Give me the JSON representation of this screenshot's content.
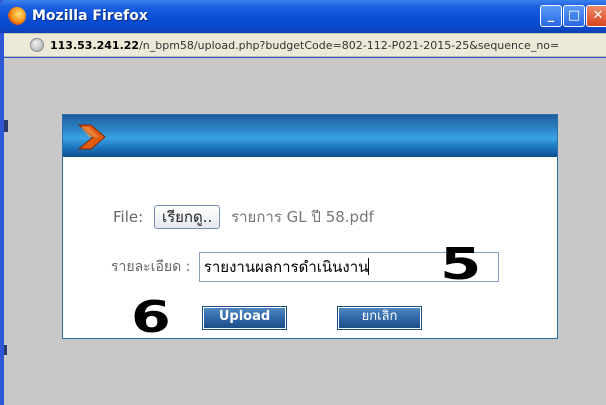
{
  "window": {
    "title": "Mozilla Firefox",
    "controls": {
      "minimize": "_",
      "maximize": "□",
      "close": "✕"
    }
  },
  "address_bar": {
    "host": "113.53.241.22",
    "path": "/n_bpm58/upload.php?budgetCode=802-112-P021-2015-25&sequence_no="
  },
  "dialog": {
    "file_label": "File:",
    "browse_label": "เรียกดู..",
    "file_name": "รายการ GL ปี 58.pdf",
    "detail_label": "รายละเอียด :",
    "detail_value": "รายงานผลการดำเนินงาน",
    "upload_label": "Upload",
    "cancel_label": "ยกเลิก"
  },
  "annotations": {
    "five": "5",
    "six": "6"
  },
  "colors": {
    "titlebar": "#0a4fd6",
    "dialog_header": "#2d86c9",
    "button": "#2f67a8",
    "content_bg": "#c8c8c8",
    "arrow": "#e05a12"
  },
  "icons": [
    "firefox-icon",
    "globe-icon",
    "arrow-icon"
  ]
}
